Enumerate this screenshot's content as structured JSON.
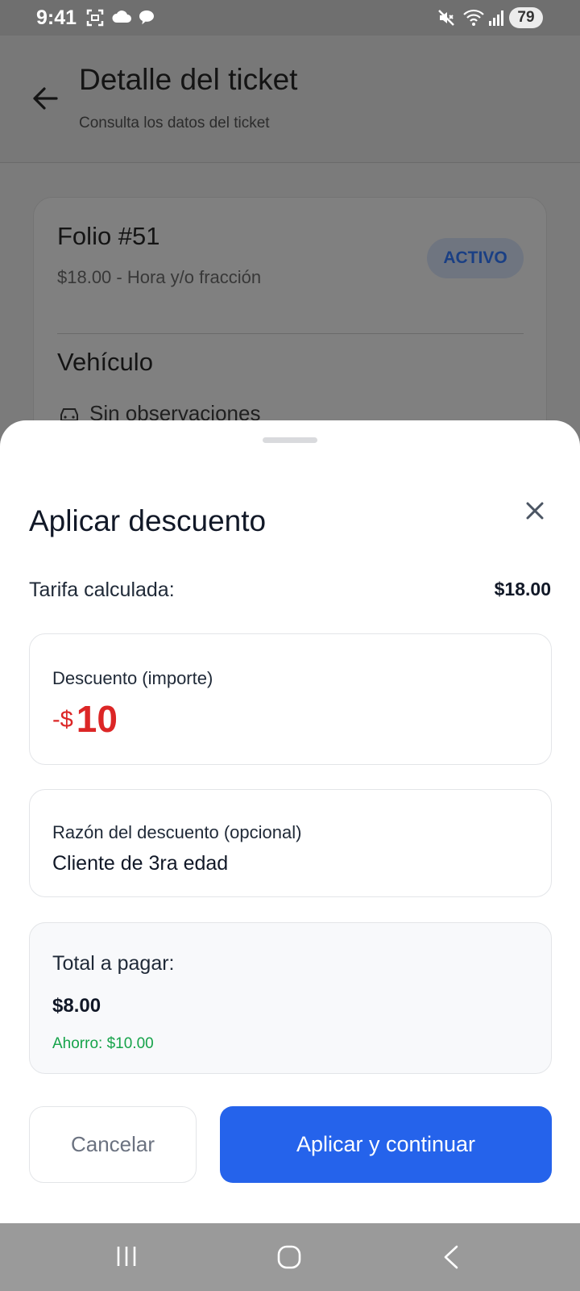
{
  "status_bar": {
    "time": "9:41",
    "battery": "79",
    "icons": [
      "screenshot-icon",
      "cloud-icon",
      "chat-icon",
      "mute-icon",
      "wifi-icon",
      "signal-icon"
    ]
  },
  "header": {
    "title": "Detalle del ticket",
    "subtitle": "Consulta los datos del ticket"
  },
  "ticket": {
    "folio": "Folio #51",
    "rate": "$18.00 - Hora y/o fracción",
    "status": "ACTIVO",
    "vehicle_title": "Vehículo",
    "observations": "Sin observaciones"
  },
  "sheet": {
    "title": "Aplicar descuento",
    "calc_label": "Tarifa calculada:",
    "calc_value": "$18.00",
    "discount": {
      "label": "Descuento (importe)",
      "prefix": "-$",
      "value": "10"
    },
    "reason": {
      "label": "Razón del descuento (opcional)",
      "value": "Cliente de 3ra edad"
    },
    "total": {
      "label": "Total a pagar:",
      "value": "$8.00",
      "savings": "Ahorro: $10.00"
    },
    "buttons": {
      "cancel": "Cancelar",
      "apply": "Aplicar y continuar"
    }
  },
  "colors": {
    "primary": "#2563eb",
    "discount": "#dc2626",
    "savings": "#16a34a",
    "status_pill_text": "#1a3f84"
  }
}
